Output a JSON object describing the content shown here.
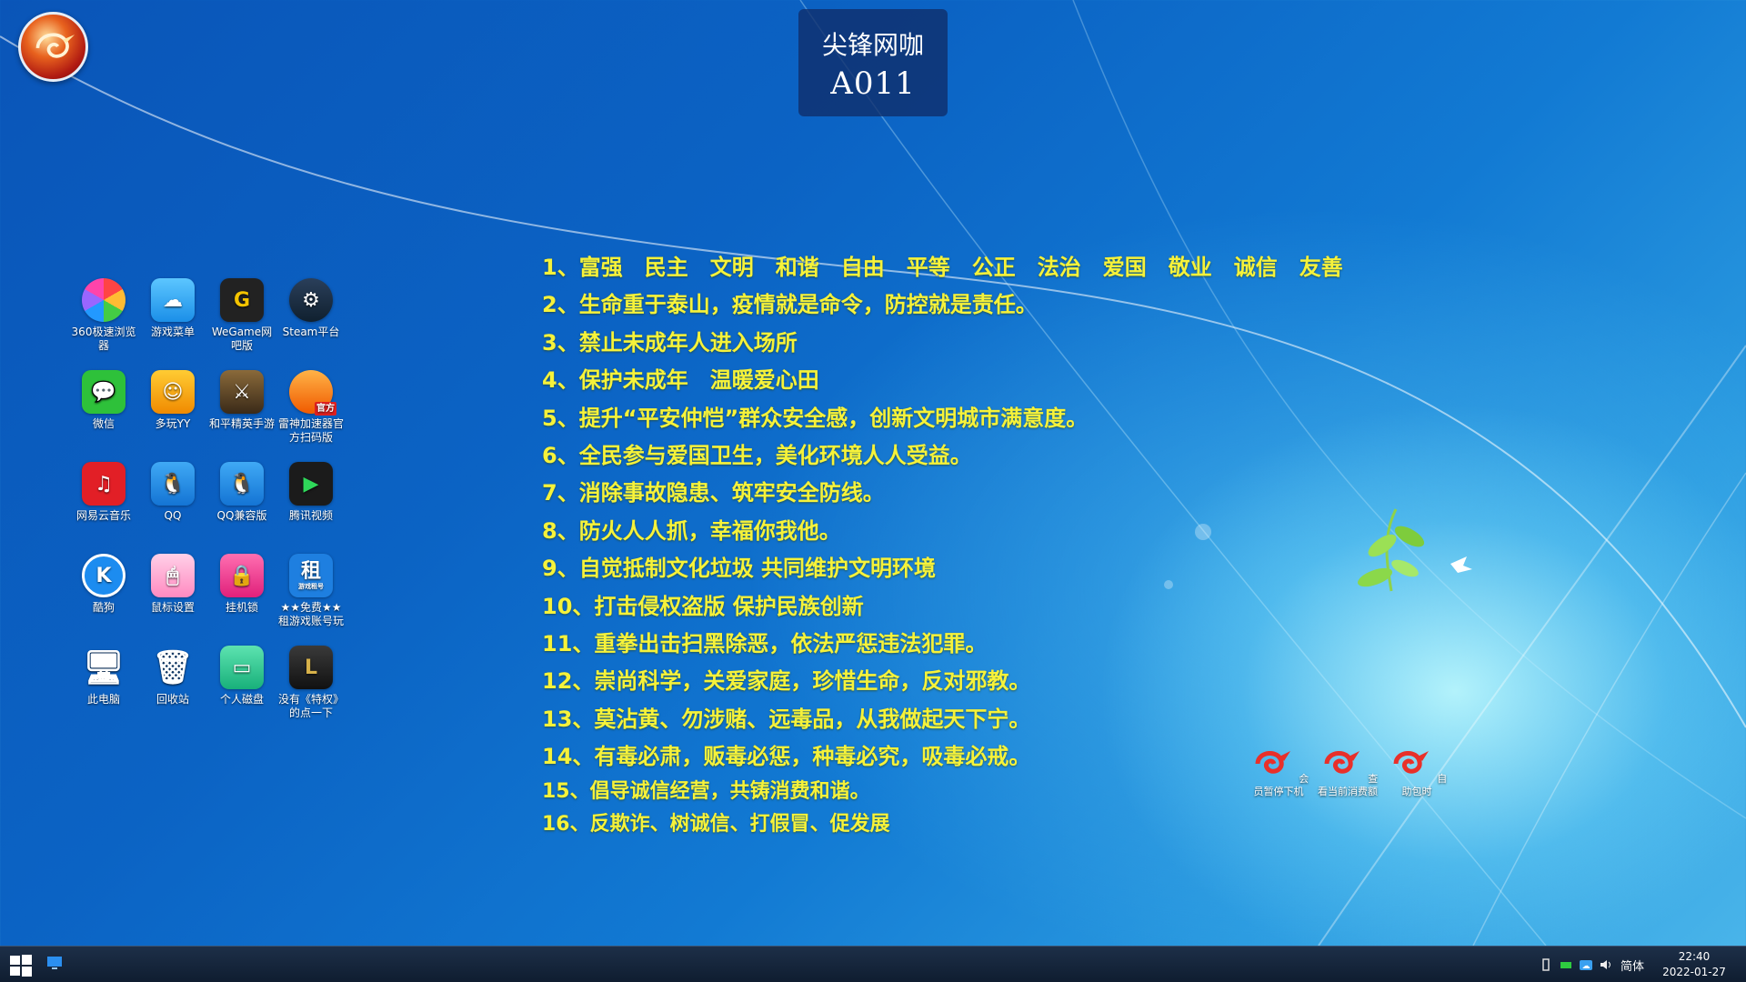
{
  "cafe": {
    "name": "尖锋网咖",
    "seat": "A011"
  },
  "desktop_icons": [
    {
      "label": "360极速浏览器",
      "icon": "360-browser-icon"
    },
    {
      "label": "游戏菜单",
      "icon": "game-menu-icon"
    },
    {
      "label": "WeGame网吧版",
      "icon": "wegame-icon"
    },
    {
      "label": "Steam平台",
      "icon": "steam-icon"
    },
    {
      "label": "微信",
      "icon": "wechat-icon"
    },
    {
      "label": "多玩YY",
      "icon": "yy-icon"
    },
    {
      "label": "和平精英手游",
      "icon": "pubg-mobile-icon"
    },
    {
      "label": "雷神加速器官方扫码版",
      "icon": "leishen-accelerator-icon",
      "badge": "官方"
    },
    {
      "label": "网易云音乐",
      "icon": "netease-music-icon"
    },
    {
      "label": "QQ",
      "icon": "qq-icon"
    },
    {
      "label": "QQ兼容版",
      "icon": "qq-compat-icon"
    },
    {
      "label": "腾讯视频",
      "icon": "tencent-video-icon"
    },
    {
      "label": "酷狗",
      "icon": "kugou-icon",
      "glyph": "K"
    },
    {
      "label": "鼠标设置",
      "icon": "mouse-settings-icon"
    },
    {
      "label": "挂机锁",
      "icon": "hang-lock-icon"
    },
    {
      "label": "★★免费★★租游戏账号玩",
      "icon": "rent-account-icon",
      "glyph": "租",
      "badge": "游戏租号"
    },
    {
      "label": "此电脑",
      "icon": "this-pc-icon"
    },
    {
      "label": "回收站",
      "icon": "recycle-bin-icon"
    },
    {
      "label": "个人磁盘",
      "icon": "personal-disk-icon"
    },
    {
      "label": "没有《特权》的点一下",
      "icon": "privilege-icon"
    }
  ],
  "slogans": [
    "1、富强　民主　文明　和谐　自由　平等　公正　法治　爱国　敬业　诚信　友善",
    "2、生命重于泰山，疫情就是命令，防控就是责任。",
    "3、禁止未成年人进入场所",
    "4、保护未成年　温暖爱心田",
    "5、提升“平安仲恺”群众安全感，创新文明城市满意度。",
    "6、全民参与爱国卫生，美化环境人人受益。",
    "7、消除事故隐患、筑牢安全防线。",
    "8、防火人人抓，幸福你我他。",
    "9、自觉抵制文化垃圾 共同维护文明环境",
    "10、打击侵权盗版 保护民族创新",
    "11、重拳出击扫黑除恶，依法严惩违法犯罪。",
    "12、崇尚科学，关爱家庭，珍惜生命，反对邪教。",
    "13、莫沾黄、勿涉赌、远毒品，从我做起天下宁。",
    "14、有毒必肃，贩毒必惩，种毒必究，吸毒必戒。",
    "15、倡导诚信经营，共铸消费和谐。",
    "16、反欺诈、树诚信、打假冒、促发展"
  ],
  "cafe_tools": [
    {
      "label": "会员暂停下机",
      "icon": "pause-logout-icon"
    },
    {
      "label": "查看当前消费额",
      "icon": "view-consumption-icon"
    },
    {
      "label": "自助包时",
      "icon": "self-package-icon"
    }
  ],
  "taskbar": {
    "ime": "简体",
    "time": "22:40",
    "date": "2022-01-27"
  },
  "colors": {
    "slogan": "#f6f23a",
    "taskbar": "#13223a"
  }
}
